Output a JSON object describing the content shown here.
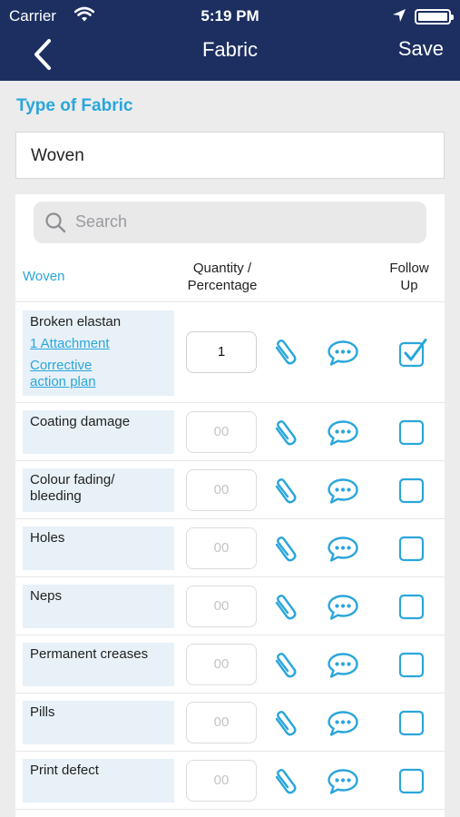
{
  "status": {
    "carrier": "Carrier",
    "time": "5:19 PM"
  },
  "nav": {
    "title": "Fabric",
    "save": "Save"
  },
  "section_label": "Type of Fabric",
  "fabric_value": "Woven",
  "search": {
    "placeholder": "Search"
  },
  "table": {
    "type_header": "Woven",
    "qty_header_line1": "Quantity /",
    "qty_header_line2": "Percentage",
    "follow_header_line1": "Follow",
    "follow_header_line2": "Up"
  },
  "rows": [
    {
      "name": "Broken elastan",
      "attachment": "1 Attachment",
      "corrective_line1": "Corrective",
      "corrective_line2": "action plan",
      "qty": "1",
      "checked": true
    },
    {
      "name": "Coating damage",
      "qty": "00",
      "checked": false
    },
    {
      "name_line1": "Colour fading/",
      "name_line2": "bleeding",
      "qty": "00",
      "checked": false
    },
    {
      "name": "Holes",
      "qty": "00",
      "checked": false
    },
    {
      "name": "Neps",
      "qty": "00",
      "checked": false
    },
    {
      "name": "Permanent creases",
      "qty": "00",
      "checked": false
    },
    {
      "name": "Pills",
      "qty": "00",
      "checked": false
    },
    {
      "name": "Print defect",
      "qty": "00",
      "checked": false
    }
  ],
  "colors": {
    "navbar": "#1d2f61",
    "accent": "#2aa6db",
    "name_cell": "#e8f1f8"
  },
  "icons": [
    "back-chevron-icon",
    "wifi-icon",
    "location-arrow-icon",
    "battery-icon",
    "search-icon",
    "paperclip-icon",
    "chat-bubble-icon",
    "checkbox-icon"
  ]
}
